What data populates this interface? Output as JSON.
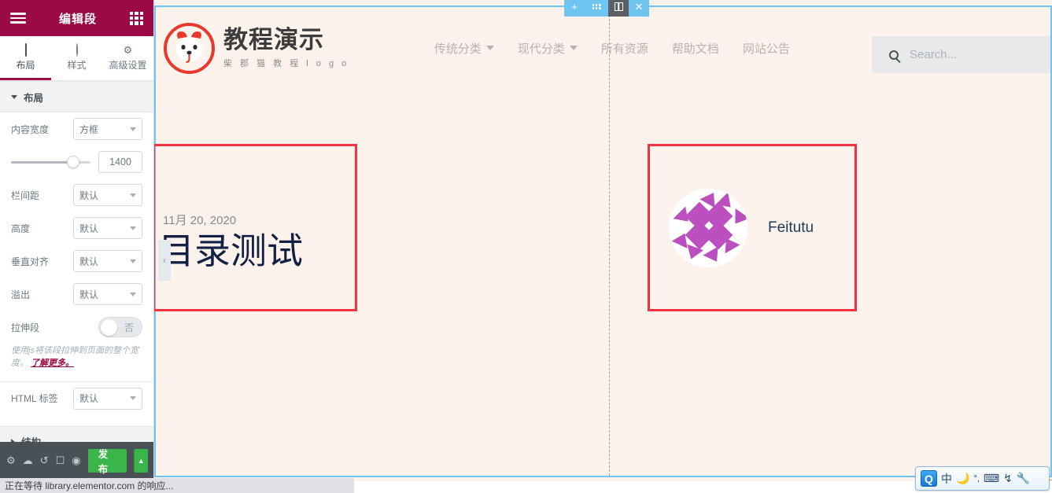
{
  "panel": {
    "header": {
      "title": "编辑段",
      "menu_icon": "hamburger-icon",
      "widgets_icon": "grid-icon"
    },
    "tabs": [
      {
        "label": "布局",
        "icon": "layout-icon",
        "active": true
      },
      {
        "label": "样式",
        "icon": "contrast-icon",
        "active": false
      },
      {
        "label": "高级设置",
        "icon": "gear-icon",
        "active": false
      }
    ],
    "sections": [
      {
        "label": "布局",
        "expanded": true
      },
      {
        "label": "结构",
        "expanded": false
      }
    ],
    "controls": {
      "content_width_label": "内容宽度",
      "content_width_value": "方框",
      "width_number": "1400",
      "column_gap_label": "栏间距",
      "column_gap_value": "默认",
      "height_label": "高度",
      "height_value": "默认",
      "vertical_align_label": "垂直对齐",
      "vertical_align_value": "默认",
      "overflow_label": "溢出",
      "overflow_value": "默认",
      "stretch_label": "拉伸段",
      "stretch_value": "否",
      "stretch_hint": "使用js将该段拉伸到页面的整个宽度。",
      "stretch_hint_link": "了解更多。",
      "html_tag_label": "HTML 标签",
      "html_tag_value": "默认"
    },
    "footer": {
      "publish_label": "发布",
      "icons": [
        "settings-icon",
        "navigator-icon",
        "history-icon",
        "responsive-icon",
        "preview-icon"
      ]
    }
  },
  "section_toolbar": {
    "add_icon": "plus-icon",
    "drag_icon": "drag-dots-icon",
    "columns_icon": "columns-icon",
    "close_icon": "close-icon"
  },
  "site": {
    "logo": {
      "title": "教程演示",
      "subtitle": "柴 郡 猫 教 程 l o g o",
      "mark": "dog-avatar-icon"
    },
    "nav": [
      {
        "label": "传统分类",
        "has_dropdown": true
      },
      {
        "label": "现代分类",
        "has_dropdown": true
      },
      {
        "label": "所有资源",
        "has_dropdown": false
      },
      {
        "label": "帮助文档",
        "has_dropdown": false
      },
      {
        "label": "网站公告",
        "has_dropdown": false
      }
    ],
    "search": {
      "placeholder": "Search...",
      "icon": "search-icon"
    }
  },
  "content": {
    "post": {
      "date": "11月 20, 2020",
      "title": "目录测试",
      "prev_arrow": "‹"
    },
    "author": {
      "name": "Feitutu",
      "avatar": "geometric-avatar-icon"
    }
  },
  "browser": {
    "status_text": "正在等待 library.elementor.com 的响应..."
  },
  "ime": {
    "logo": "Q",
    "mode": "中",
    "icons": [
      "moon-icon",
      "punctuation-icon",
      "keyboard-icon",
      "toolbox-icon",
      "wrench-icon"
    ]
  },
  "colors": {
    "panel_header": "#9b0a46",
    "accent_cyan": "#6ec6f0",
    "highlight_red": "#f5333f",
    "page_bg": "#fdf3ec",
    "publish_green": "#39b54a"
  }
}
